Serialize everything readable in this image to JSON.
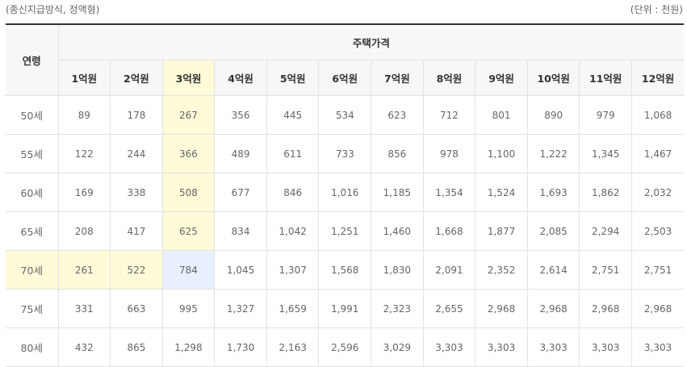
{
  "caption": {
    "left": "(종신지급방식, 정액형)",
    "right": "(단위 : 천원)"
  },
  "table": {
    "age_header": "연령",
    "group_header": "주택가격",
    "price_headers": [
      "1억원",
      "2억원",
      "3억원",
      "4억원",
      "5억원",
      "6억원",
      "7억원",
      "8억원",
      "9억원",
      "10억원",
      "11억원",
      "12억원"
    ],
    "rows": [
      {
        "age": "50세",
        "values": [
          "89",
          "178",
          "267",
          "356",
          "445",
          "534",
          "623",
          "712",
          "801",
          "890",
          "979",
          "1,068"
        ]
      },
      {
        "age": "55세",
        "values": [
          "122",
          "244",
          "366",
          "489",
          "611",
          "733",
          "856",
          "978",
          "1,100",
          "1,222",
          "1,345",
          "1,467"
        ]
      },
      {
        "age": "60세",
        "values": [
          "169",
          "338",
          "508",
          "677",
          "846",
          "1,016",
          "1,185",
          "1,354",
          "1,524",
          "1,693",
          "1,862",
          "2,032"
        ]
      },
      {
        "age": "65세",
        "values": [
          "208",
          "417",
          "625",
          "834",
          "1,042",
          "1,251",
          "1,460",
          "1,668",
          "1,877",
          "2,085",
          "2,294",
          "2,503"
        ]
      },
      {
        "age": "70세",
        "values": [
          "261",
          "522",
          "784",
          "1,045",
          "1,307",
          "1,568",
          "1,830",
          "2,091",
          "2,352",
          "2,614",
          "2,751",
          "2,751"
        ]
      },
      {
        "age": "75세",
        "values": [
          "331",
          "663",
          "995",
          "1,327",
          "1,659",
          "1,991",
          "2,323",
          "2,655",
          "2,968",
          "2,968",
          "2,968",
          "2,968"
        ]
      },
      {
        "age": "80세",
        "values": [
          "432",
          "865",
          "1,298",
          "1,730",
          "2,163",
          "2,596",
          "3,029",
          "3,303",
          "3,303",
          "3,303",
          "3,303",
          "3,303"
        ]
      }
    ]
  },
  "colors": {
    "highlight_yellow": "#fffbd9",
    "highlight_blue": "#e8efff",
    "header_bg": "#f7f7f7"
  }
}
